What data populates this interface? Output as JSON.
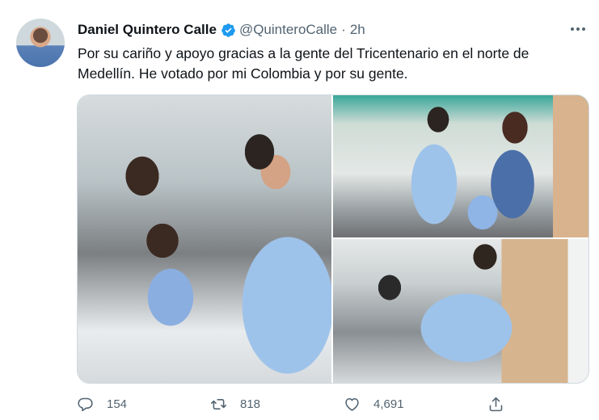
{
  "tweet": {
    "author_name": "Daniel Quintero Calle",
    "handle": "@QuinteroCalle",
    "separator": "·",
    "time": "2h",
    "text": "Por su cariño y apoyo gracias a la gente del Tricentenario en el norte de Medellín. He votado por mi Colombia y por su gente.",
    "photo_count": 3
  },
  "actions": {
    "replies": "154",
    "retweets": "818",
    "likes": "4,691"
  },
  "colors": {
    "verified": "#1d9bf0",
    "secondary_text": "#536471",
    "primary_text": "#0f1419"
  },
  "icons": [
    "verified-badge-icon",
    "more-options-icon",
    "reply-icon",
    "retweet-icon",
    "like-icon",
    "share-icon"
  ]
}
